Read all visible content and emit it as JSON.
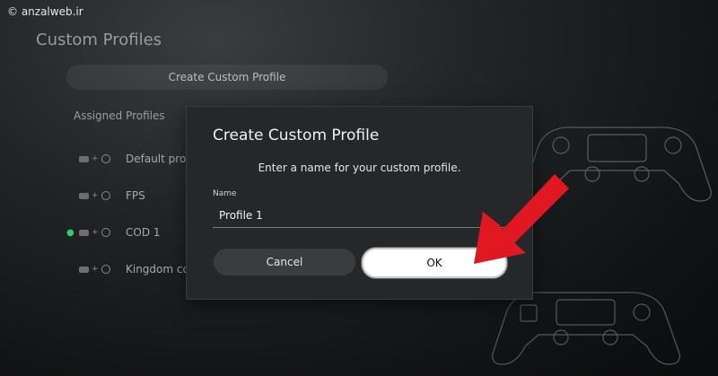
{
  "watermark": {
    "text": "© anzalweb.ir"
  },
  "page": {
    "title": "Custom Profiles",
    "create_button": "Create Custom Profile",
    "assigned_label": "Assigned Profiles",
    "profiles": [
      {
        "name": "Default profil",
        "selected": false
      },
      {
        "name": "FPS",
        "selected": false
      },
      {
        "name": "COD 1",
        "selected": true
      },
      {
        "name": "Kingdom con",
        "selected": false
      }
    ],
    "combo_plus": "+"
  },
  "dialog": {
    "title": "Create Custom Profile",
    "instruction": "Enter a name for your custom profile.",
    "name_label": "Name",
    "name_value": "Profile 1",
    "cancel_label": "Cancel",
    "ok_label": "OK"
  },
  "colors": {
    "annotation_arrow": "#e01822",
    "selected_dot": "#2bd16b"
  }
}
